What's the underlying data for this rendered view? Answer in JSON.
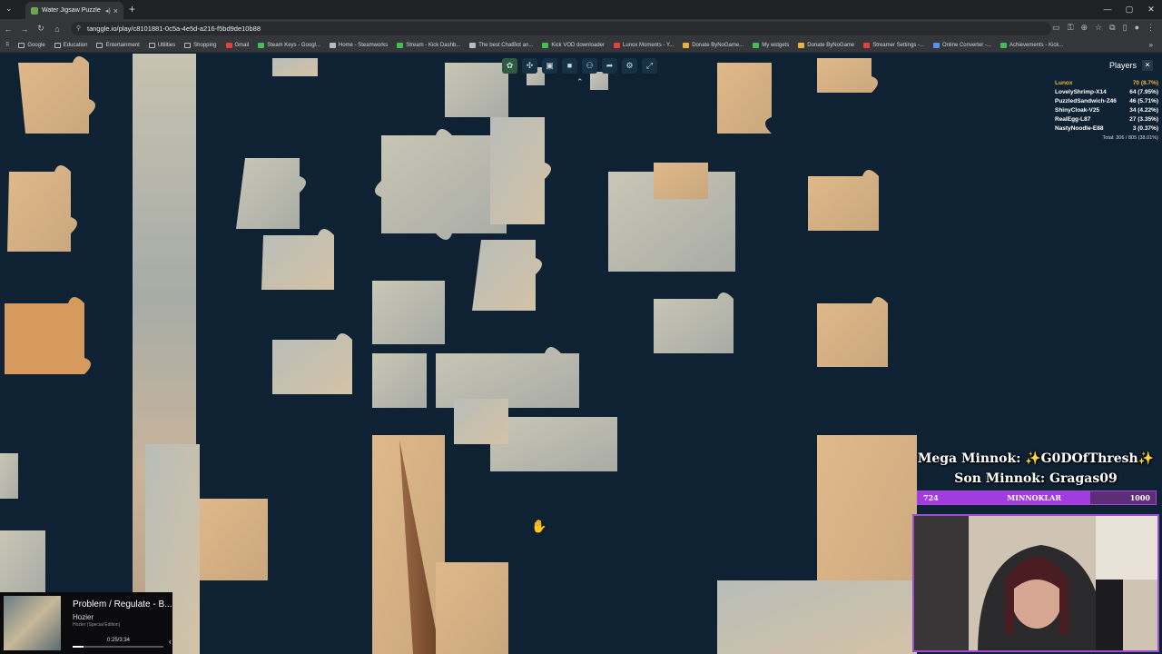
{
  "browser": {
    "tab_title": "Water Jigsaw Puzzle",
    "url": "tanggle.io/play/c8101881-0c5a-4e5d-a216-f5bd9de10b88",
    "bookmarks": [
      "Google",
      "Education",
      "Entertainment",
      "Utilities",
      "Shopping",
      "Gmail",
      "Steam Keys - Googl...",
      "Home - Steamworks",
      "Stream - Kick Dashb...",
      "The best ChatBot an...",
      "Kick VOD downloader",
      "Lunox Moments - Y...",
      "Donate ByNoGame...",
      "My widgets",
      "Donate ByNoGame",
      "Streamer Settings -...",
      "Online Converter -...",
      "Achievements - Kick..."
    ]
  },
  "players": {
    "title": "Players",
    "list": [
      {
        "name": "Lunox",
        "score": "70 (8.7%)"
      },
      {
        "name": "LovelyShrimp-X14",
        "score": "64 (7.95%)"
      },
      {
        "name": "PuzzledSandwich-Z46",
        "score": "46 (5.71%)"
      },
      {
        "name": "ShinyCloak-V25",
        "score": "34 (4.22%)"
      },
      {
        "name": "RealEgg-L87",
        "score": "27 (3.35%)"
      },
      {
        "name": "NastyNoodle-E88",
        "score": "3 (0.37%)"
      }
    ],
    "total": "Total: 306 / 805 (38.01%)"
  },
  "overlay": {
    "mega": "Mega Minnok: ✨G0DOfThresh✨",
    "son": "Son Minnok: Gragas09",
    "bar_left": "724",
    "bar_label": "MINNOKLAR",
    "bar_right": "1000",
    "bar_progress": 0.724
  },
  "music": {
    "song": "Problem / Regulate - B...",
    "artist": "Hozier",
    "album": "Hozier (Special Edition)",
    "time": "0:25/3:34",
    "progress": 0.117
  },
  "colors": {
    "leader": "#f0b23a",
    "accent": "#9b4fd0",
    "board": "#0f2233"
  }
}
